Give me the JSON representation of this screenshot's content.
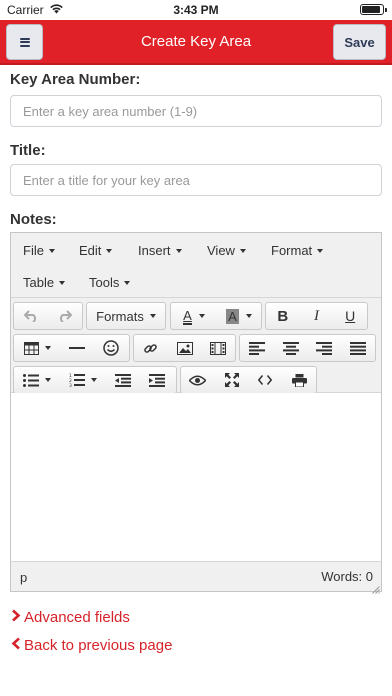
{
  "status_bar": {
    "carrier": "Carrier",
    "time": "3:43 PM",
    "battery_level": 0.95
  },
  "nav": {
    "title": "Create Key Area",
    "save_label": "Save",
    "accent_color": "#e02127"
  },
  "form": {
    "key_area_label": "Key Area Number:",
    "key_area_placeholder": "Enter a key area number (1-9)",
    "title_label": "Title:",
    "title_placeholder": "Enter a title for your key area",
    "notes_label": "Notes:"
  },
  "editor": {
    "menus": [
      "File",
      "Edit",
      "Insert",
      "View",
      "Format",
      "Table",
      "Tools"
    ],
    "formats_label": "Formats",
    "text_color_glyph": "A",
    "bg_color_glyph": "A",
    "bold_glyph": "B",
    "italic_glyph": "I",
    "underline_glyph": "U",
    "path": "p",
    "word_count": "Words: 0"
  },
  "links": {
    "advanced": "Advanced fields",
    "back": "Back to previous page"
  }
}
